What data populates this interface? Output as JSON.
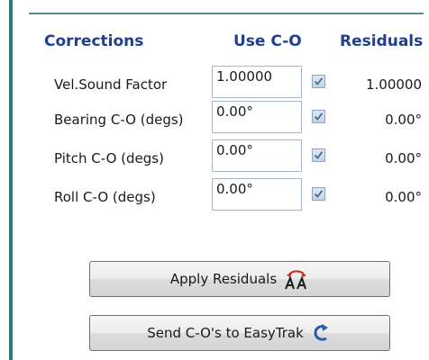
{
  "headers": {
    "corrections": "Corrections",
    "use_co": "Use C-O",
    "residuals": "Residuals"
  },
  "rows": [
    {
      "label": "Vel.Sound Factor",
      "value": "1.00000",
      "checked": true,
      "residual": "1.00000"
    },
    {
      "label": "Bearing C-O (degs)",
      "value": "0.00°",
      "checked": true,
      "residual": "0.00°"
    },
    {
      "label": "Pitch C-O (degs)",
      "value": "0.00°",
      "checked": true,
      "residual": "0.00°"
    },
    {
      "label": "Roll C-O (degs)",
      "value": "0.00°",
      "checked": true,
      "residual": "0.00°"
    }
  ],
  "buttons": {
    "apply": {
      "label": "Apply Residuals",
      "icon": "apply-residuals-icon"
    },
    "send": {
      "label": "Send C-O's to EasyTrak",
      "icon": "refresh-arrow-icon"
    }
  },
  "colors": {
    "header_text": "#1f3f8f",
    "accent_bar": "#2e7a7d",
    "icon_red": "#d6261c",
    "icon_blue": "#2a5db0"
  }
}
